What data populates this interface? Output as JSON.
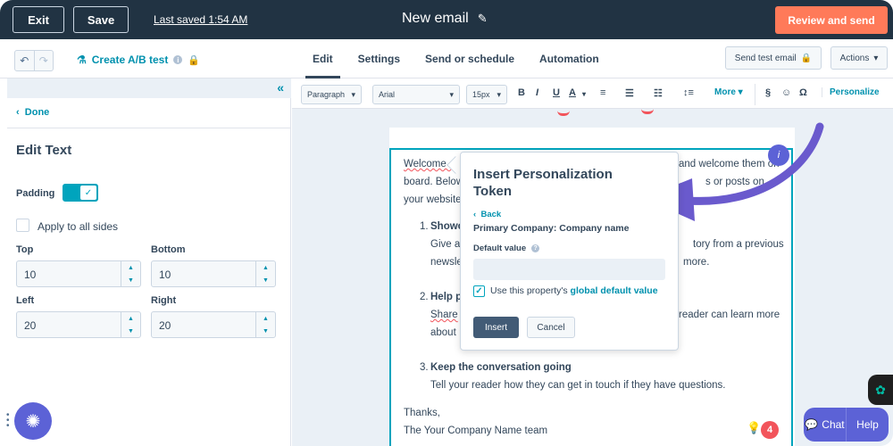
{
  "topbar": {
    "exit_label": "Exit",
    "save_label": "Save",
    "last_saved": "Last saved 1:54 AM",
    "title": "New email",
    "review_label": "Review and send"
  },
  "subbar": {
    "ab_test_label": "Create A/B test",
    "tabs": [
      "Edit",
      "Settings",
      "Send or schedule",
      "Automation"
    ],
    "active_tab": "Edit",
    "send_test_label": "Send test email",
    "actions_label": "Actions"
  },
  "left_panel": {
    "done_label": "Done",
    "heading": "Edit Text",
    "padding_label": "Padding",
    "padding_enabled": true,
    "apply_all_label": "Apply to all sides",
    "apply_all_checked": false,
    "fields": {
      "top_label": "Top",
      "top_value": "10",
      "bottom_label": "Bottom",
      "bottom_value": "10",
      "left_label": "Left",
      "left_value": "20",
      "right_label": "Right",
      "right_value": "20"
    }
  },
  "toolbar": {
    "block_style": "Paragraph",
    "font": "Arial",
    "size": "15px",
    "more_label": "More",
    "personalize_label": "Personalize"
  },
  "email": {
    "line1a": "Welcome ,",
    "line1b": "and welcome them on",
    "line2a": "board. Below",
    "line2b": "s or posts on",
    "line3a": "your website",
    "item1_num": "1.",
    "item1_title": "Showc",
    "item1_l1a": "Give a",
    "item1_l1b": "tory from a previous",
    "item1_l2a": "newsle",
    "item1_l2b": "more.",
    "item2_num": "2.",
    "item2_title": "Help p",
    "item2_l1a": "Share",
    "item2_l1b": "reader can learn more",
    "item2_l2a": "about",
    "item3_num": "3.",
    "item3_title": "Keep the conversation going",
    "item3_line": "Tell your reader how they can get in touch if they have questions.",
    "thanks": "Thanks,",
    "signature": "The Your Company Name team"
  },
  "popover": {
    "title": "Insert Personalization Token",
    "back_label": "Back",
    "property": "Primary Company: Company name",
    "default_label": "Default value",
    "default_value": "",
    "checkbox_text": "Use this property's",
    "checkbox_link": "global default value",
    "checkbox_checked": true,
    "insert_label": "Insert",
    "cancel_label": "Cancel"
  },
  "widgets": {
    "chat_label": "Chat",
    "help_label": "Help",
    "notification_count": "4"
  },
  "colors": {
    "topbar": "#213343",
    "accent": "#00a4bd",
    "link": "#0091ae",
    "review": "#ff7a59",
    "arrow": "#6a5acd"
  }
}
